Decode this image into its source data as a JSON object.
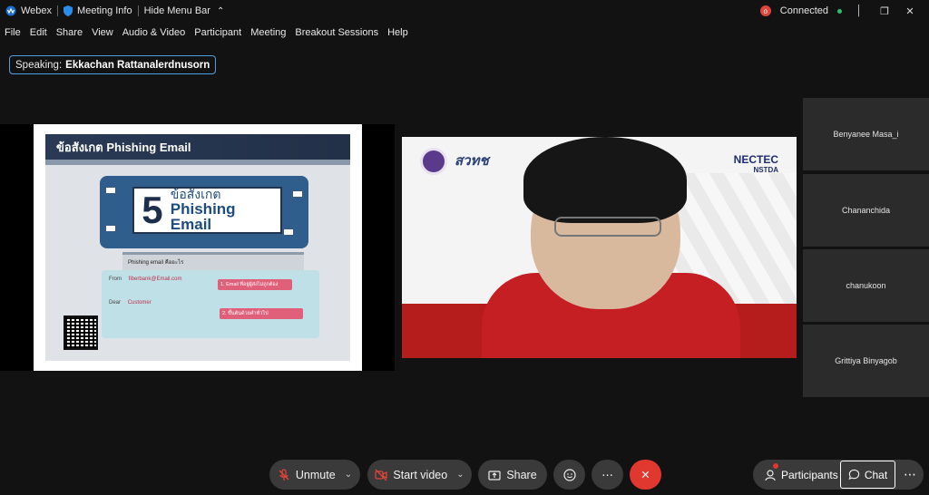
{
  "titlebar": {
    "app_name": "Webex",
    "meeting_info": "Meeting Info",
    "hide_menu": "Hide Menu Bar",
    "connection_status": "Connected",
    "badge": "o"
  },
  "menu": [
    "File",
    "Edit",
    "Share",
    "View",
    "Audio & Video",
    "Participant",
    "Meeting",
    "Breakout Sessions",
    "Help"
  ],
  "speaking": {
    "label": "Speaking:",
    "name": "Ekkachan Rattanalerdnusorn"
  },
  "slide": {
    "title": "ข้อสังเกต Phishing Email",
    "big_number": "5",
    "line1": "ข้อสังเกต",
    "line2": "Phishing Email",
    "note_label": "Phishing email คืออะไร",
    "from_label": "From",
    "from_value": "fiberbank@Email.com",
    "dear_label": "Dear",
    "dear_value": "Customer",
    "callout1": "1. Email ที่อยู่ผู้ส่งไม่ถูกต้อง",
    "callout2": "2. ขึ้นต้นด้วยคำทั่วไป"
  },
  "video": {
    "brand": "สวทช",
    "nectec": "NECTEC",
    "nstda": "NSTDA"
  },
  "participants": [
    "Benyanee Masa_i",
    "Chananchida",
    "chanukoon",
    "Grittiya Binyagob"
  ],
  "controls": {
    "unmute": "Unmute",
    "start_video": "Start video",
    "share": "Share",
    "participants": "Participants",
    "chat": "Chat"
  }
}
